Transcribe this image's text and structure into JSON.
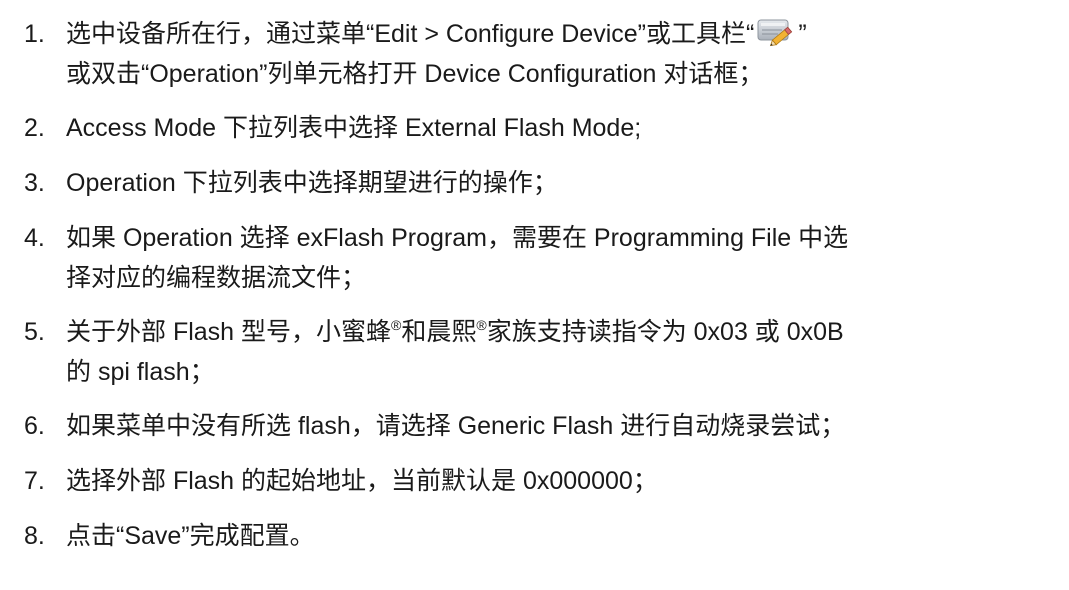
{
  "items": [
    {
      "num": "1.",
      "line1_a": "选中设备所在行，通过菜单“Edit > Configure Device”或工具栏“",
      "toolbar_icon": "edit-pencil-icon",
      "line1_b": "”",
      "line2": "或双击“Operation”列单元格打开 Device Configuration 对话框；"
    },
    {
      "num": "2.",
      "text": "Access Mode 下拉列表中选择 External Flash Mode;"
    },
    {
      "num": "3.",
      "text": "Operation 下拉列表中选择期望进行的操作；"
    },
    {
      "num": "4.",
      "line1": "如果 Operation 选择 exFlash Program，需要在 Programming File  中选",
      "line2": "择对应的编程数据流文件；"
    },
    {
      "num": "5.",
      "line1_a": "关于外部 Flash 型号，小蜜蜂",
      "reg1": "®",
      "line1_b": "和晨熙",
      "reg2": "®",
      "line1_c": "家族支持读指令为 0x03 或 0x0B",
      "line2": "的 spi flash；"
    },
    {
      "num": "6.",
      "text": "如果菜单中没有所选 flash，请选择 Generic Flash 进行自动烧录尝试；"
    },
    {
      "num": "7.",
      "text": "选择外部 Flash 的起始地址，当前默认是 0x000000；"
    },
    {
      "num": "8.",
      "text": "点击“Save”完成配置。"
    }
  ],
  "colors": {
    "text": "#1a1a1a",
    "icon_body": "#c9ced6",
    "icon_pencil": "#f2b233"
  }
}
